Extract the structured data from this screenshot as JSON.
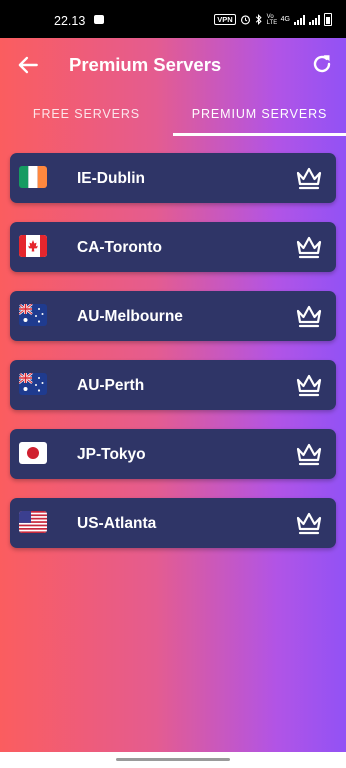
{
  "status_bar": {
    "time": "22.13",
    "vpn_label": "VPN",
    "network_label": "Vo LTE",
    "network_type": "4G"
  },
  "app_bar": {
    "title": "Premium Servers",
    "back_icon": "arrow-left-icon",
    "refresh_icon": "refresh-icon"
  },
  "tabs": [
    {
      "label": "FREE SERVERS",
      "selected": false
    },
    {
      "label": "PREMIUM SERVERS",
      "selected": true
    }
  ],
  "servers": [
    {
      "name": "IE-Dublin",
      "flag": "ireland-flag-icon",
      "badge": "crown-icon"
    },
    {
      "name": "CA-Toronto",
      "flag": "canada-flag-icon",
      "badge": "crown-icon"
    },
    {
      "name": "AU-Melbourne",
      "flag": "australia-flag-icon",
      "badge": "crown-icon"
    },
    {
      "name": "AU-Perth",
      "flag": "australia-flag-icon",
      "badge": "crown-icon"
    },
    {
      "name": "JP-Tokyo",
      "flag": "japan-flag-icon",
      "badge": "crown-icon"
    },
    {
      "name": "US-Atlanta",
      "flag": "usa-flag-icon",
      "badge": "crown-icon"
    }
  ],
  "colors": {
    "gradient_start": "#fb5d5f",
    "gradient_end": "#9252f5",
    "card_background": "#2f3567",
    "text": "#ffffff"
  }
}
